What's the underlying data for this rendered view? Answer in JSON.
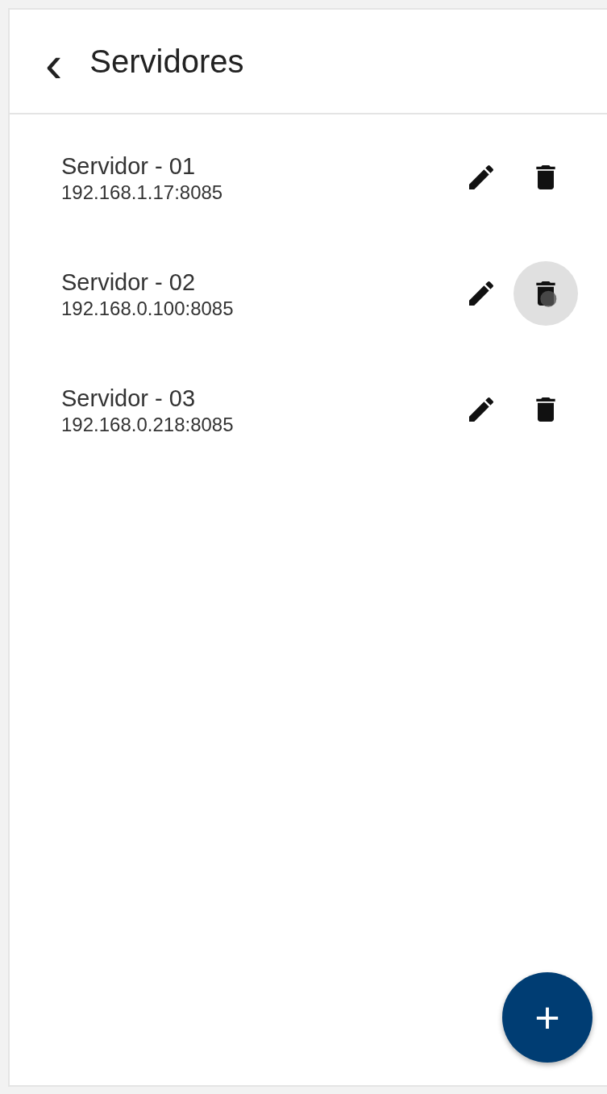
{
  "header": {
    "back": "‹",
    "title": "Servidores"
  },
  "servers": [
    {
      "name": "Servidor - 01",
      "address": "192.168.1.17:8085",
      "delete_pressed": false
    },
    {
      "name": "Servidor - 02",
      "address": "192.168.0.100:8085",
      "delete_pressed": true
    },
    {
      "name": "Servidor - 03",
      "address": "192.168.0.218:8085",
      "delete_pressed": false
    }
  ],
  "fab": {
    "label": "+"
  }
}
